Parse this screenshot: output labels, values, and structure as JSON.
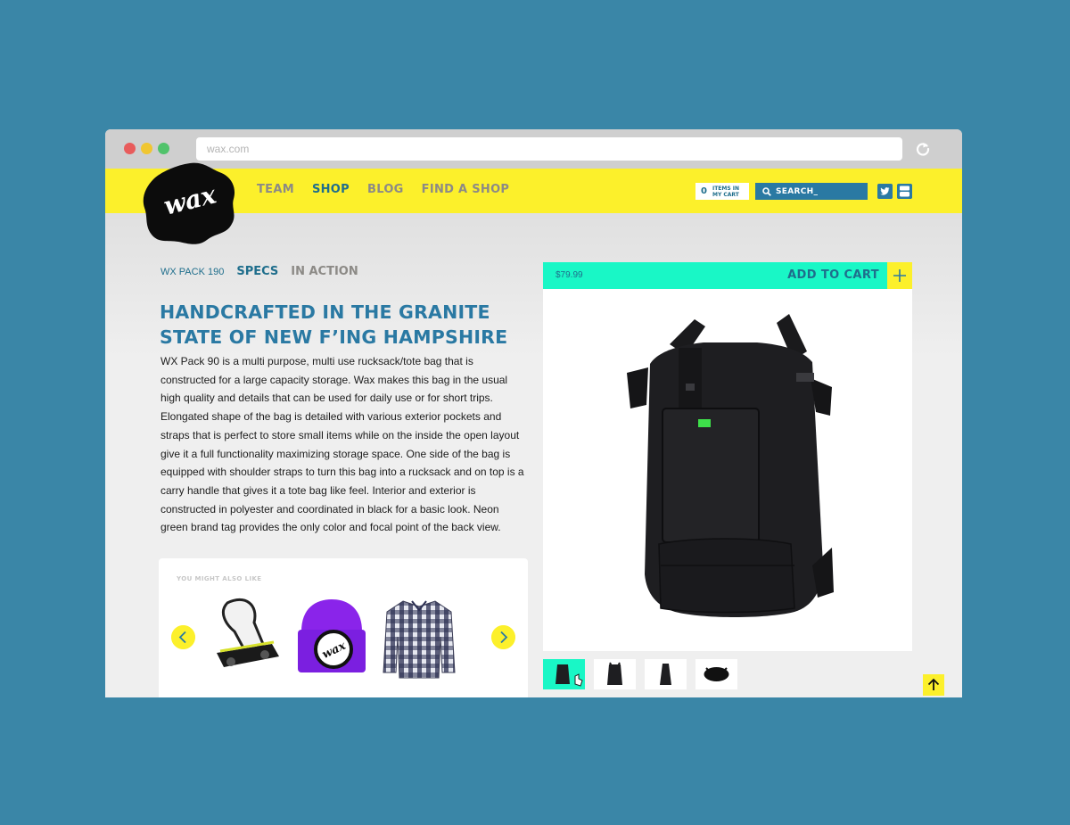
{
  "browser": {
    "url": "wax.com"
  },
  "nav": {
    "logo_text": "wax",
    "links": [
      {
        "label": "TEAM",
        "active": false
      },
      {
        "label": "SHOP",
        "active": true
      },
      {
        "label": "BLOG",
        "active": false
      },
      {
        "label": "FIND A SHOP",
        "active": false
      }
    ],
    "cart": {
      "count": "0",
      "label": "ITEMS IN MY CART"
    },
    "search": {
      "placeholder": "SEARCH_"
    },
    "social": [
      "twitter-icon",
      "youtube-icon"
    ]
  },
  "product": {
    "breadcrumb": "WX PACK 190",
    "tabs": [
      {
        "label": "SPECS",
        "active": true
      },
      {
        "label": "IN ACTION",
        "active": false
      }
    ],
    "headline_line1": "HANDCRAFTED IN THE GRANITE",
    "headline_line2": "STATE OF NEW F’ING HAMPSHIRE",
    "description": "WX Pack 90 is a multi purpose, multi use rucksack/tote bag that is constructed for a large capacity storage. Wax makes this bag in the usual high quality and details that can be used for daily use or for short trips. Elongated shape of the bag is detailed with various exterior pockets and straps that is perfect to store small items while on the inside the open layout give it a full functionality maximizing storage space. One side of the bag is equipped with shoulder straps to turn this bag into a rucksack and on top is a carry handle that gives it a tote bag like feel. Interior and exterior is constructed in polyester and coordinated in black for a basic look. Neon green brand tag provides the only color and focal point of the back view.",
    "price": "$79.99",
    "add_to_cart": "ADD TO CART",
    "plus": "+",
    "thumbnails": [
      "front",
      "back",
      "side",
      "top"
    ],
    "active_thumbnail": 0
  },
  "related": {
    "title": "YOU MIGHT ALSO LIKE",
    "items": [
      "snowboard-binding",
      "purple-beanie",
      "plaid-shirt"
    ],
    "beanie_patch_text": "wax"
  },
  "colors": {
    "yellow": "#fcf02b",
    "blue": "#2a79a3",
    "teal": "#19f7c6",
    "background": "#3a86a7"
  }
}
